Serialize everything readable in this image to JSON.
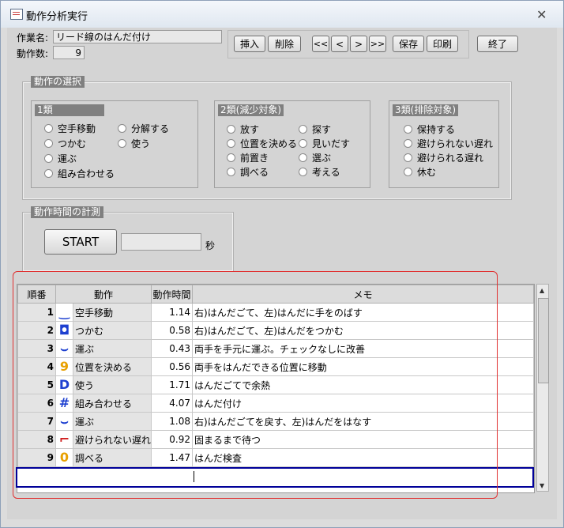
{
  "window": {
    "title": "動作分析実行"
  },
  "header": {
    "task_label": "作業名:",
    "task_value": "リード線のはんだ付け",
    "count_label": "動作数:",
    "count_value": "9"
  },
  "toolbar": {
    "insert": "挿入",
    "delete": "削除",
    "first": "<<",
    "prev": "<",
    "next": ">",
    "last": ">>",
    "save": "保存",
    "print": "印刷",
    "end": "終了"
  },
  "selection": {
    "title": "動作の選択",
    "class1": {
      "title": "1類",
      "options": [
        "空手移動",
        "分解する",
        "つかむ",
        "使う",
        "運ぶ",
        "組み合わせる"
      ]
    },
    "class2": {
      "title": "2類(減少対象)",
      "options": [
        "放す",
        "探す",
        "位置を決める",
        "見いだす",
        "前置き",
        "選ぶ",
        "調べる",
        "考える"
      ]
    },
    "class3": {
      "title": "3類(排除対象)",
      "options": [
        "保持する",
        "避けられない遅れ",
        "避けられる遅れ",
        "休む"
      ]
    }
  },
  "timing": {
    "title": "動作時間の計測",
    "start": "START",
    "unit": "秒",
    "value": ""
  },
  "table": {
    "headers": [
      "順番",
      "動作",
      "動作時間",
      "メモ"
    ],
    "rows": [
      {
        "num": "1",
        "icon": "‿",
        "icon_color": "#1e40d0",
        "name": "空手移動",
        "time": "1.14",
        "memo": "右)はんだごて、左)はんだに手をのばす"
      },
      {
        "num": "2",
        "icon": "◘",
        "icon_color": "#1e40d0",
        "name": "つかむ",
        "time": "0.58",
        "memo": "右)はんだごて、左)はんだをつかむ"
      },
      {
        "num": "3",
        "icon": "⌣",
        "icon_color": "#1e40d0",
        "name": "運ぶ",
        "time": "0.43",
        "memo": "両手を手元に運ぶ。チェックなしに改善"
      },
      {
        "num": "4",
        "icon": "9",
        "icon_color": "#e8a000",
        "name": "位置を決める",
        "time": "0.56",
        "memo": "両手をはんだできる位置に移動"
      },
      {
        "num": "5",
        "icon": "D",
        "icon_color": "#1e40d0",
        "name": "使う",
        "time": "1.71",
        "memo": "はんだごてで余熱"
      },
      {
        "num": "6",
        "icon": "#",
        "icon_color": "#1e40d0",
        "name": "組み合わせる",
        "time": "4.07",
        "memo": "はんだ付け"
      },
      {
        "num": "7",
        "icon": "⌣",
        "icon_color": "#1e40d0",
        "name": "運ぶ",
        "time": "1.08",
        "memo": " 右)はんだごてを戻す、左)はんだをはなす"
      },
      {
        "num": "8",
        "icon": "⌐",
        "icon_color": "#d02020",
        "name": "避けられない遅れ",
        "time": "0.92",
        "memo": "固まるまで待つ"
      },
      {
        "num": "9",
        "icon": "0",
        "icon_color": "#e8a000",
        "name": "調べる",
        "time": "1.47",
        "memo": "はんだ検査"
      }
    ]
  }
}
